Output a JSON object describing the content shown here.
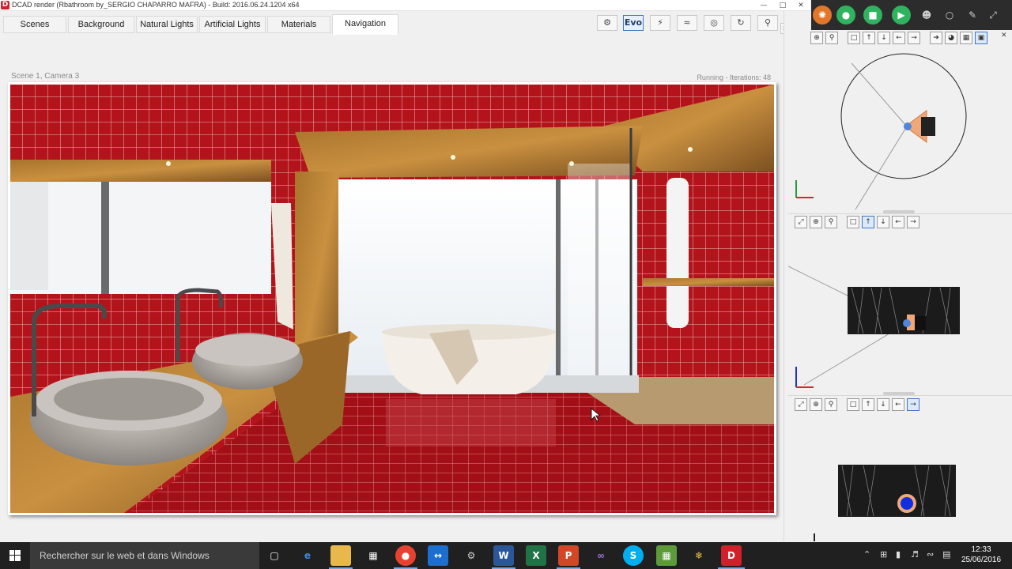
{
  "window": {
    "title": "DCAD render (Rbathroom by_SERGIO CHAPARRO MAFRA) - Build: 2016.06.24.1204 x64",
    "logo": "D"
  },
  "tabs": [
    {
      "label": "Scenes"
    },
    {
      "label": "Background"
    },
    {
      "label": "Natural Lights"
    },
    {
      "label": "Artificial Lights"
    },
    {
      "label": "Materials"
    },
    {
      "label": "Navigation",
      "active": true
    }
  ],
  "toolbar": {
    "evo_label": "Evo",
    "icons": [
      "camera-link-icon",
      "evo-button",
      "flash-icon",
      "double-flash-icon",
      "nodes-icon",
      "rotate-icon",
      "zoom-icon"
    ]
  },
  "render": {
    "scene_label": "Scene 1, Camera 3",
    "status": "Running - Iterations: 48"
  },
  "hud": {
    "icons": [
      "honeycomb-icon",
      "microphone-icon",
      "chat-icon",
      "video-icon",
      "people-icon",
      "comment-icon",
      "pen-icon",
      "expand-icon"
    ]
  },
  "taskbar": {
    "search_placeholder": "Rechercher sur le web et dans Windows",
    "time": "12:33",
    "date": "25/06/2016",
    "apps": [
      "task-view",
      "edge",
      "file-explorer",
      "store",
      "chrome",
      "teamviewer",
      "tools",
      "word",
      "excel",
      "powerpoint",
      "visual-studio",
      "skype",
      "minecraft",
      "snowflake-app",
      "dcad-render"
    ]
  }
}
